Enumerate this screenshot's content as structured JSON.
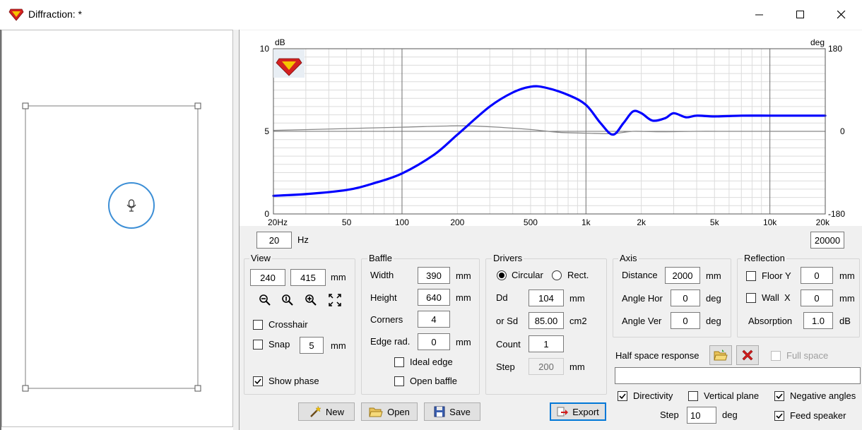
{
  "window": {
    "title": "Diffraction: *"
  },
  "graph": {
    "left_unit": "dB",
    "right_unit": "deg",
    "y_left_ticks": [
      "10",
      "5",
      "0"
    ],
    "y_right_ticks": [
      "180",
      "0",
      "-180"
    ],
    "x_ticks": [
      "20Hz",
      "50",
      "100",
      "200",
      "500",
      "1k",
      "2k",
      "5k",
      "10k",
      "20k"
    ]
  },
  "chart_data": {
    "type": "line",
    "x_scale": "log",
    "xlim": [
      20,
      20000
    ],
    "ylim": [
      0,
      10
    ],
    "y2lim": [
      -180,
      180
    ],
    "grid": true,
    "series": [
      {
        "axis": "left",
        "color": "#0000ff",
        "x": [
          20,
          30,
          50,
          70,
          100,
          150,
          200,
          300,
          400,
          500,
          600,
          800,
          1000,
          1200,
          1400,
          1600,
          1800,
          2000,
          2300,
          2700,
          3000,
          3500,
          4000,
          5000,
          7000,
          10000,
          15000,
          20000
        ],
        "y": [
          1.1,
          1.2,
          1.45,
          1.85,
          2.45,
          3.6,
          4.8,
          6.5,
          7.35,
          7.7,
          7.65,
          7.2,
          6.6,
          5.5,
          4.8,
          5.5,
          6.2,
          6.1,
          5.65,
          5.8,
          6.1,
          5.85,
          5.95,
          5.9,
          5.95,
          5.95,
          5.95,
          5.95
        ]
      },
      {
        "axis": "right",
        "color": "#888888",
        "x": [
          20,
          50,
          100,
          200,
          300,
          500,
          700,
          1000,
          1400,
          1800,
          2500,
          4000,
          7000,
          20000
        ],
        "y": [
          2,
          6,
          9,
          12,
          10,
          4,
          -2,
          -4,
          -5,
          0,
          -1,
          0,
          0,
          0
        ]
      }
    ]
  },
  "freq": {
    "min": "20",
    "max": "20000",
    "unit": "Hz"
  },
  "view": {
    "title": "View",
    "width": "240",
    "height": "415",
    "unit": "mm",
    "crosshair_label": "Crosshair",
    "snap_label": "Snap",
    "snap_value": "5",
    "snap_unit": "mm",
    "show_phase_label": "Show phase"
  },
  "baffle": {
    "title": "Baffle",
    "width_label": "Width",
    "width": "390",
    "width_unit": "mm",
    "height_label": "Height",
    "height": "640",
    "height_unit": "mm",
    "corners_label": "Corners",
    "corners": "4",
    "edge_label": "Edge rad.",
    "edge": "0",
    "edge_unit": "mm",
    "ideal_edge_label": "Ideal edge",
    "open_baffle_label": "Open baffle"
  },
  "drivers": {
    "title": "Drivers",
    "circular_label": "Circular",
    "rect_label": "Rect.",
    "dd_label": "Dd",
    "dd": "104",
    "dd_unit": "mm",
    "sd_label": "or Sd",
    "sd": "85.00",
    "sd_unit": "cm2",
    "count_label": "Count",
    "count": "1",
    "step_label": "Step",
    "step": "200",
    "step_unit": "mm"
  },
  "axis": {
    "title": "Axis",
    "distance_label": "Distance",
    "distance": "2000",
    "distance_unit": "mm",
    "angle_hor_label": "Angle Hor",
    "angle_hor": "0",
    "angle_hor_unit": "deg",
    "angle_ver_label": "Angle Ver",
    "angle_ver": "0",
    "angle_ver_unit": "deg"
  },
  "reflection": {
    "title": "Reflection",
    "floor_label": "Floor Y",
    "floor": "0",
    "floor_unit": "mm",
    "wall_label": "Wall  X",
    "wall": "0",
    "wall_unit": "mm",
    "absorption_label": "Absorption",
    "absorption": "1.0",
    "absorption_unit": "dB"
  },
  "half_space": {
    "label": "Half space response",
    "full_space_label": "Full space",
    "file_path": ""
  },
  "options": {
    "directivity_label": "Directivity",
    "vertical_plane_label": "Vertical plane",
    "negative_angles_label": "Negative angles",
    "step_label": "Step",
    "step": "10",
    "step_unit": "deg",
    "feed_speaker_label": "Feed speaker"
  },
  "buttons": {
    "new": "New",
    "open": "Open",
    "save": "Save",
    "export": "Export"
  },
  "colors": {
    "accent": "#0078d7",
    "response": "#0000ff",
    "phase": "#888888",
    "driver": "#3d8fd6"
  }
}
